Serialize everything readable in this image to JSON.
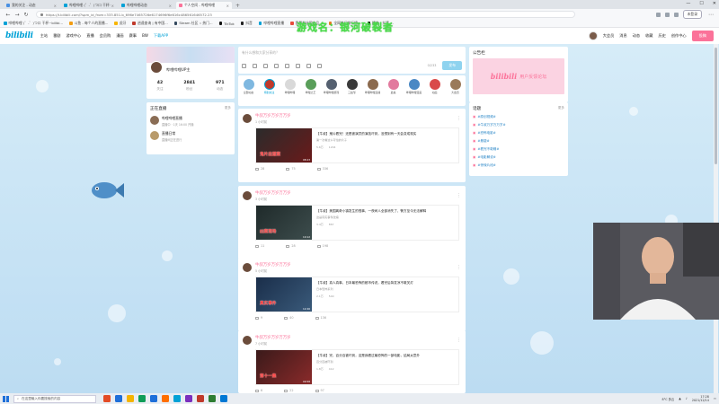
{
  "browser": {
    "tabs": [
      {
        "label": "我的关注 - 动态",
        "color": "#4a90e2"
      },
      {
        "label": "哔哩哔哩 (゜-゜)つロ 干杯~bilibili",
        "color": "#00a1d6"
      },
      {
        "label": "哔哩哔哩动态",
        "color": "#00a1d6"
      },
      {
        "label": "个人空间 - 哔哩哔哩",
        "color": "#fb7299",
        "active": true
      }
    ],
    "url": "https://t.bilibili.com/?spm_id_from=333.851.b_696e7465726e6174696f6e616c486561646572.23",
    "login_label": "未登录",
    "bookmarks": [
      {
        "label": "哔哩哔哩 (゜-゜)つロ 干杯~bilibi...",
        "color": "#00a1d6"
      },
      {
        "label": "斗鱼 - 每个人的直播...",
        "color": "#f39c12"
      },
      {
        "label": "虎牙",
        "color": "#f7b500"
      },
      {
        "label": "逍遥查询 | 有中国...",
        "color": "#c0392b"
      },
      {
        "label": "Steam 社区 :: 热门...",
        "color": "#34495e"
      },
      {
        "label": "TikTok",
        "color": "#111111"
      },
      {
        "label": "抖音",
        "color": "#222222"
      },
      {
        "label": "哔哩哔哩直播",
        "color": "#00a1d6"
      },
      {
        "label": "我是粉丝团出品...",
        "color": "#e74c3c"
      },
      {
        "label": "全网热门排行榜...",
        "color": "#e67e22"
      },
      {
        "label": "精选 - 抖音 ...",
        "color": "#111111"
      }
    ]
  },
  "overlay_title": "游戏名：银河破裂者",
  "header": {
    "logo": "bilibili",
    "nav": [
      "主站",
      "番剧",
      "游戏中心",
      "直播",
      "会员购",
      "漫画",
      "赛事",
      "BW"
    ],
    "download": "下载APP",
    "right": [
      "大会员",
      "消息",
      "动态",
      "收藏",
      "历史",
      "创作中心"
    ],
    "upload": "投稿"
  },
  "profile": {
    "name": "哔哩哔哩UP主",
    "stats": [
      {
        "num": "42",
        "label": "关注"
      },
      {
        "num": "2841",
        "label": "粉丝"
      },
      {
        "num": "971",
        "label": "动态"
      }
    ]
  },
  "live": {
    "title": "正在直播",
    "more": "更多",
    "items": [
      {
        "title": "哔哩哔哩直播",
        "sub": "直播中 · 1天 16:00 开播"
      },
      {
        "title": "直播日常",
        "sub": "直播间正在进行"
      }
    ]
  },
  "composer": {
    "placeholder": "有什么想和大家分享的？",
    "count": "0/233",
    "send": "发布"
  },
  "follows": [
    {
      "label": "全部动态",
      "color": "#7fb8e0"
    },
    {
      "label": "特别关注",
      "color": "#c0392b",
      "active": true
    },
    {
      "label": "哔哩哔哩",
      "color": "#d9d9d9"
    },
    {
      "label": "哔哩之王",
      "color": "#5a9e5a"
    },
    {
      "label": "哔哩哔哩游戏",
      "color": "#556070"
    },
    {
      "label": "三姑爷",
      "color": "#3a3a3a"
    },
    {
      "label": "哔哩哔哩直播",
      "color": "#8b6a4e"
    },
    {
      "label": "最美",
      "color": "#e27a9e"
    },
    {
      "label": "哔哩哔哩漫画",
      "color": "#4a88c4"
    },
    {
      "label": "动画",
      "color": "#d94a4a"
    },
    {
      "label": "大会员",
      "color": "#9a7a5a"
    }
  ],
  "posts": [
    {
      "name": "牛叔万岁万岁万万岁",
      "time": "1 小时前",
      "thumb_caption": "鬼片出道案",
      "thumb_colors": [
        "#2b2b2b",
        "#6a1a1a"
      ],
      "duration": "08:23",
      "title": "【牛叔】鬼片看完！还是被演员的演技吓到，没想到有一天会变成现实",
      "desc": "第一次看这么可怕的片子",
      "plays": "5.6万",
      "danmaku": "1204",
      "comments": "75",
      "likes": "336",
      "shares": "28"
    },
    {
      "name": "牛叔万岁万岁万万岁",
      "time": "3 小时前",
      "thumb_caption": "凶案现场",
      "thumb_colors": [
        "#1f2a2a",
        "#3d4d4d"
      ],
      "duration": "10:12",
      "title": "【牛叔】美国离奇小镇发生的怪事，一夜间人全部消失了，警方至今无法解释",
      "desc": "这是真实事件改编",
      "plays": "3.4万",
      "danmaku": "867",
      "comments": "28",
      "likes": "198",
      "shares": "11"
    },
    {
      "name": "牛叔万岁万岁万万岁",
      "time": "5 小时前",
      "thumb_caption": "真实事件",
      "thumb_colors": [
        "#1a2e4a",
        "#3a5a7a"
      ],
      "duration": "12:46",
      "title": "【牛叔】真人真事，日本最恐怖的都市传说，看完后背发凉不敢关灯",
      "desc": "日本恐怖系列",
      "plays": "2.1万",
      "danmaku": "540",
      "comments": "40",
      "likes": "136",
      "shares": "9"
    },
    {
      "name": "牛叔万岁万岁万万岁",
      "time": "7 小时前",
      "thumb_caption": "第十一集",
      "thumb_colors": [
        "#3a1a1a",
        "#8a2a2a"
      ],
      "duration": "09:58",
      "title": "【牛叔】完，百分百被吓到，这是我看过最恐怖的一部电影，结局太意外",
      "desc": "百分百被吓到",
      "plays": "1.8万",
      "danmaku": "412",
      "comments": "22",
      "likes": "97",
      "shares": "6"
    }
  ],
  "ad": {
    "title": "公告栏",
    "logo": "bilibili",
    "text": "用户反馈论坛"
  },
  "topics": {
    "title": "话题",
    "more": "更多",
    "items": [
      "#原创视频#",
      "#牛叔万岁万万岁#",
      "#恐怖电影#",
      "#悬疑#",
      "#看完不敢睡#",
      "#电影解说#",
      "#惊悚片段#"
    ]
  },
  "taskbar": {
    "search_placeholder": "在这里输入你要搜索的内容",
    "apps": [
      "#e34c26",
      "#1e6fd9",
      "#f4b400",
      "#0f9d58",
      "#1e6fd9",
      "#ff6f00",
      "#00a1d6",
      "#7b2fbe",
      "#c0392b",
      "#2e7d32",
      "#0078d4"
    ],
    "weather": "8°C 多云",
    "time": "17:28",
    "date": "2021/12/14"
  }
}
